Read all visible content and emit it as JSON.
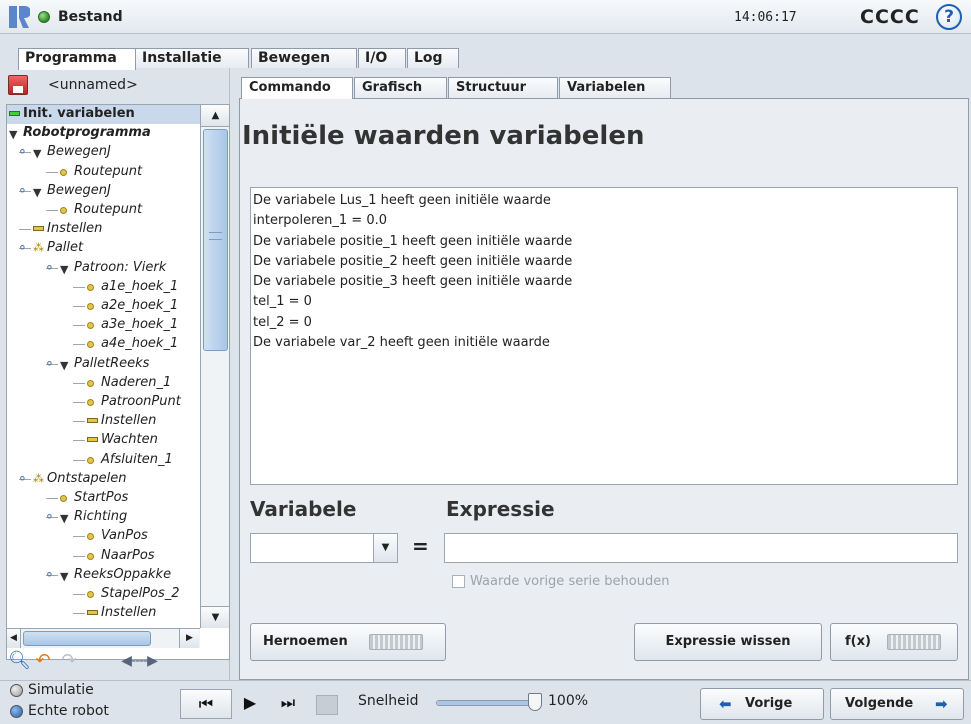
{
  "titlebar": {
    "program_state": "Bestand",
    "clock": "14:06:17",
    "robot_name": "CCCC",
    "help": "?"
  },
  "main_tabs": [
    "Programma",
    "Installatie",
    "Bewegen",
    "I/O",
    "Log"
  ],
  "left": {
    "program_name": "<unnamed>",
    "tree": [
      {
        "label": "Init. variabelen",
        "icon": "green-bar",
        "selected": true,
        "bold": true
      },
      {
        "label": "Robotprogramma",
        "icon": "triangle-down",
        "bold": true,
        "italic": true
      },
      {
        "label": "BewegenJ",
        "icon": "triangle-down",
        "italic": true
      },
      {
        "label": "Routepunt",
        "icon": "waypoint-dot",
        "italic": true
      },
      {
        "label": "BewegenJ",
        "icon": "triangle-down",
        "italic": true
      },
      {
        "label": "Routepunt",
        "icon": "waypoint-dot",
        "italic": true
      },
      {
        "label": "Instellen",
        "icon": "set-bar",
        "italic": true
      },
      {
        "label": "Pallet",
        "icon": "pallet-dots",
        "italic": true
      },
      {
        "label": "Patroon: Vierk",
        "icon": "triangle-down",
        "italic": true
      },
      {
        "label": "a1e_hoek_1",
        "icon": "waypoint-dot",
        "italic": true
      },
      {
        "label": "a2e_hoek_1",
        "icon": "waypoint-dot",
        "italic": true
      },
      {
        "label": "a3e_hoek_1",
        "icon": "waypoint-dot",
        "italic": true
      },
      {
        "label": "a4e_hoek_1",
        "icon": "waypoint-dot",
        "italic": true
      },
      {
        "label": "PalletReeks",
        "icon": "triangle-down",
        "italic": true
      },
      {
        "label": "Naderen_1",
        "icon": "waypoint-dot",
        "italic": true
      },
      {
        "label": "PatroonPunt",
        "icon": "waypoint-dot",
        "italic": true
      },
      {
        "label": "Instellen",
        "icon": "set-bar",
        "italic": true
      },
      {
        "label": "Wachten",
        "icon": "set-bar",
        "italic": true
      },
      {
        "label": "Afsluiten_1",
        "icon": "waypoint-dot",
        "italic": true
      },
      {
        "label": "Ontstapelen",
        "icon": "pallet-dots",
        "italic": true
      },
      {
        "label": "StartPos",
        "icon": "waypoint-dot",
        "italic": true
      },
      {
        "label": "Richting",
        "icon": "triangle-down",
        "italic": true
      },
      {
        "label": "VanPos",
        "icon": "waypoint-dot",
        "italic": true
      },
      {
        "label": "NaarPos",
        "icon": "waypoint-dot",
        "italic": true
      },
      {
        "label": "ReeksOppakke",
        "icon": "triangle-down",
        "italic": true
      },
      {
        "label": "StapelPos_2",
        "icon": "waypoint-dot",
        "italic": true
      },
      {
        "label": "Instellen",
        "icon": "set-bar",
        "italic": true
      }
    ],
    "tools": {
      "search": "search-icon",
      "undo": "undo-icon",
      "redo": "redo-icon",
      "move": "move-arrows-icon"
    }
  },
  "right": {
    "sub_tabs": [
      "Commando",
      "Grafisch",
      "Structuur",
      "Variabelen"
    ],
    "title": "Initiële waarden variabelen",
    "variables": [
      "De variabele Lus_1 heeft geen initiële waarde",
      "interpoleren_1 = 0.0",
      "De variabele positie_1 heeft geen initiële waarde",
      "De variabele positie_2 heeft geen initiële waarde",
      "De variabele positie_3 heeft geen initiële waarde",
      "tel_1 = 0",
      "tel_2 = 0",
      "De variabele var_2 heeft geen initiële waarde"
    ],
    "variable_label": "Variabele",
    "expression_label": "Expressie",
    "equals": "=",
    "expression_value": "",
    "keep_checkbox_label": "Waarde vorige serie behouden",
    "rename_button": "Hernoemen",
    "clear_button": "Expressie wissen",
    "fx_button": "f(x)"
  },
  "footer": {
    "simulation": "Simulatie",
    "real_robot": "Echte robot",
    "selected_mode": "Echte robot",
    "speed_label": "Snelheid",
    "speed_value": "100%",
    "speed_fraction": 1.0,
    "prev_button": "Vorige",
    "next_button": "Volgende"
  },
  "colors": {
    "accent": "#1f5fb0",
    "status_ok": "#2f8a2a",
    "selection": "#c9d8ea"
  }
}
